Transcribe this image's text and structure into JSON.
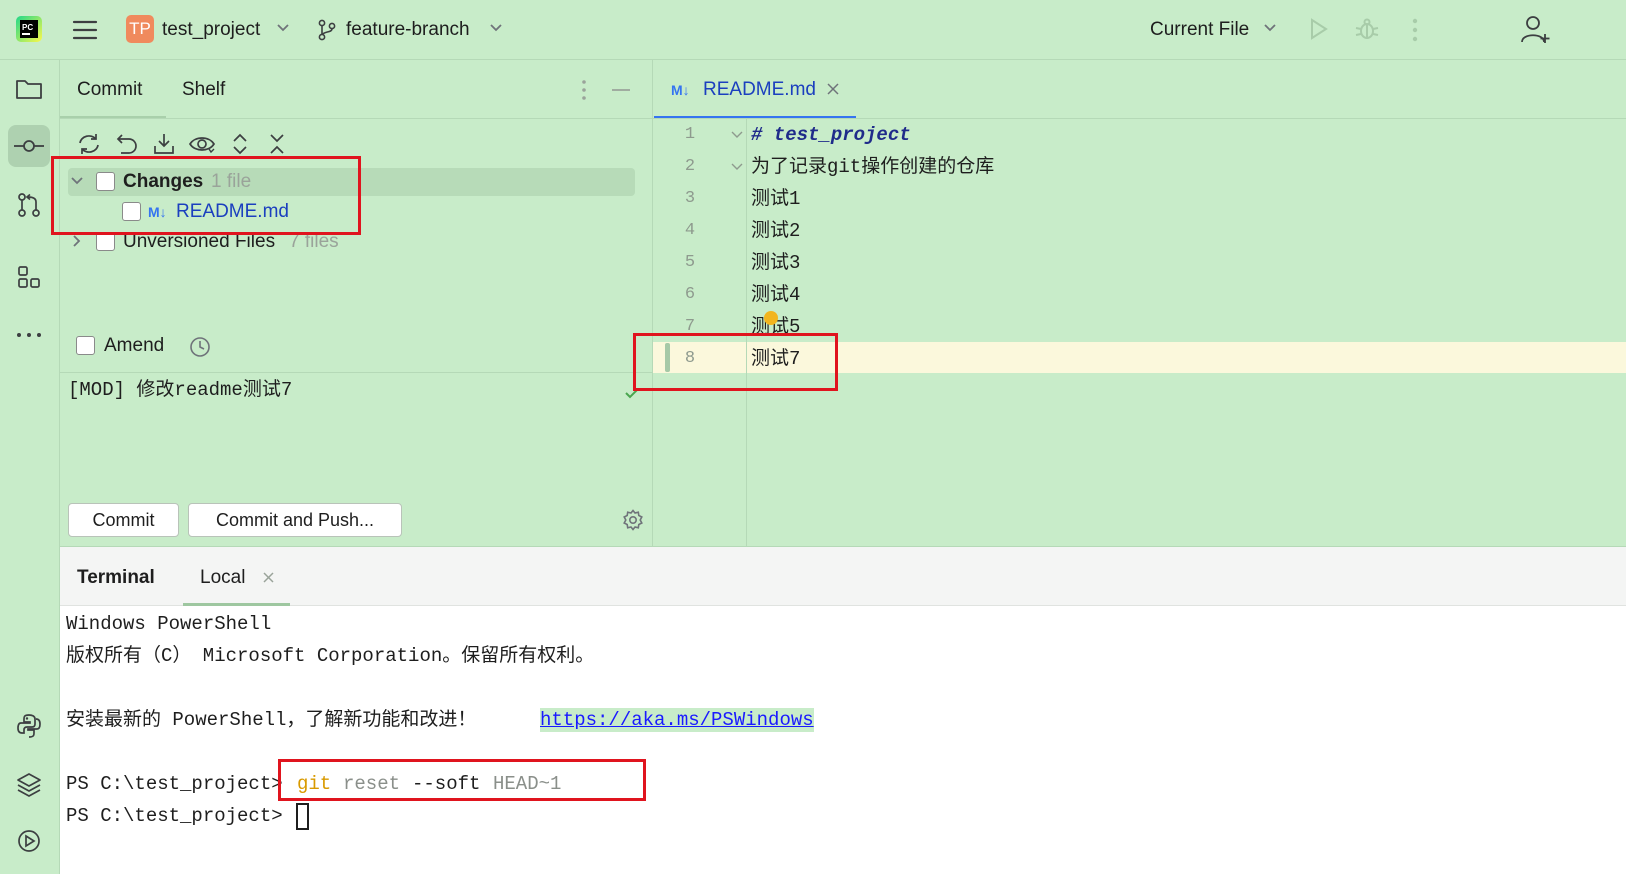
{
  "topbar": {
    "project_badge": "TP",
    "project_name": "test_project",
    "branch_name": "feature-branch",
    "run_config": "Current File"
  },
  "commit_panel": {
    "tabs": [
      "Commit",
      "Shelf"
    ],
    "changes_label": "Changes",
    "changes_count": "1 file",
    "changed_file": "README.md",
    "unversioned_label": "Unversioned Files",
    "unversioned_count": "7 files",
    "amend_label": "Amend",
    "commit_message": "[MOD] 修改readme测试7",
    "commit_button": "Commit",
    "commit_push_button": "Commit and Push..."
  },
  "editor": {
    "tab_label": "README.md",
    "md_badge": "M↓",
    "lines": [
      {
        "no": "1",
        "text": "# test_project"
      },
      {
        "no": "2",
        "text": "为了记录git操作创建的仓库"
      },
      {
        "no": "3",
        "text": "测试1"
      },
      {
        "no": "4",
        "text": "测试2"
      },
      {
        "no": "5",
        "text": "测试3"
      },
      {
        "no": "6",
        "text": "测试4"
      },
      {
        "no": "7",
        "text": "测试5"
      },
      {
        "no": "8",
        "text": "测试7"
      }
    ]
  },
  "terminal": {
    "title": "Terminal",
    "tab_label": "Local",
    "lines": [
      "Windows PowerShell",
      "版权所有（C） Microsoft Corporation。保留所有权利。",
      "",
      "安装最新的 PowerShell，了解新功能和改进！"
    ],
    "link": "https://aka.ms/PSWindows",
    "prompt": "PS C:\\test_project>",
    "cmd_git": "git",
    "cmd_rest": "reset --soft HEAD~1",
    "cmd_args1": "reset",
    "cmd_args2": "--soft",
    "cmd_args3": "HEAD~1"
  },
  "colors": {
    "background": "#c8ecc9",
    "accent": "#3574f0",
    "highlight": "#e0141e",
    "git_cmd": "#d99a00"
  }
}
